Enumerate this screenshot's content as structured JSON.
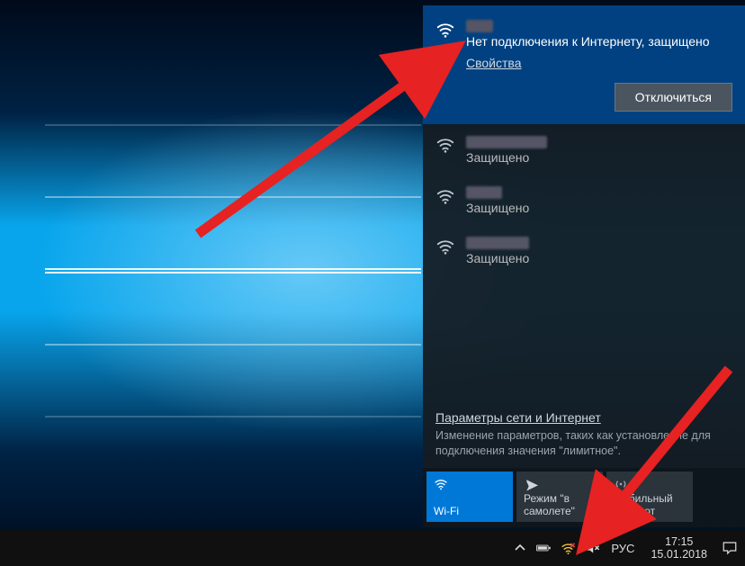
{
  "flyout": {
    "connected": {
      "ssid_hidden": true,
      "status": "Нет подключения к Интернету, защищено",
      "properties_label": "Свойства",
      "disconnect_label": "Отключиться"
    },
    "others": [
      {
        "ssid_hidden": true,
        "status": "Защищено"
      },
      {
        "ssid_hidden": true,
        "status": "Защищено"
      },
      {
        "ssid_hidden": true,
        "status": "Защищено"
      }
    ],
    "settings_link": "Параметры сети и Интернет",
    "settings_sub": "Изменение параметров, таких как установление для подключения значения \"лимитное\".",
    "tiles": {
      "wifi": "Wi-Fi",
      "airplane": "Режим \"в самолете\"",
      "hotspot": "Мобильный хот-спот"
    }
  },
  "taskbar": {
    "lang": "РУС",
    "time": "17:15",
    "date": "15.01.2018"
  }
}
